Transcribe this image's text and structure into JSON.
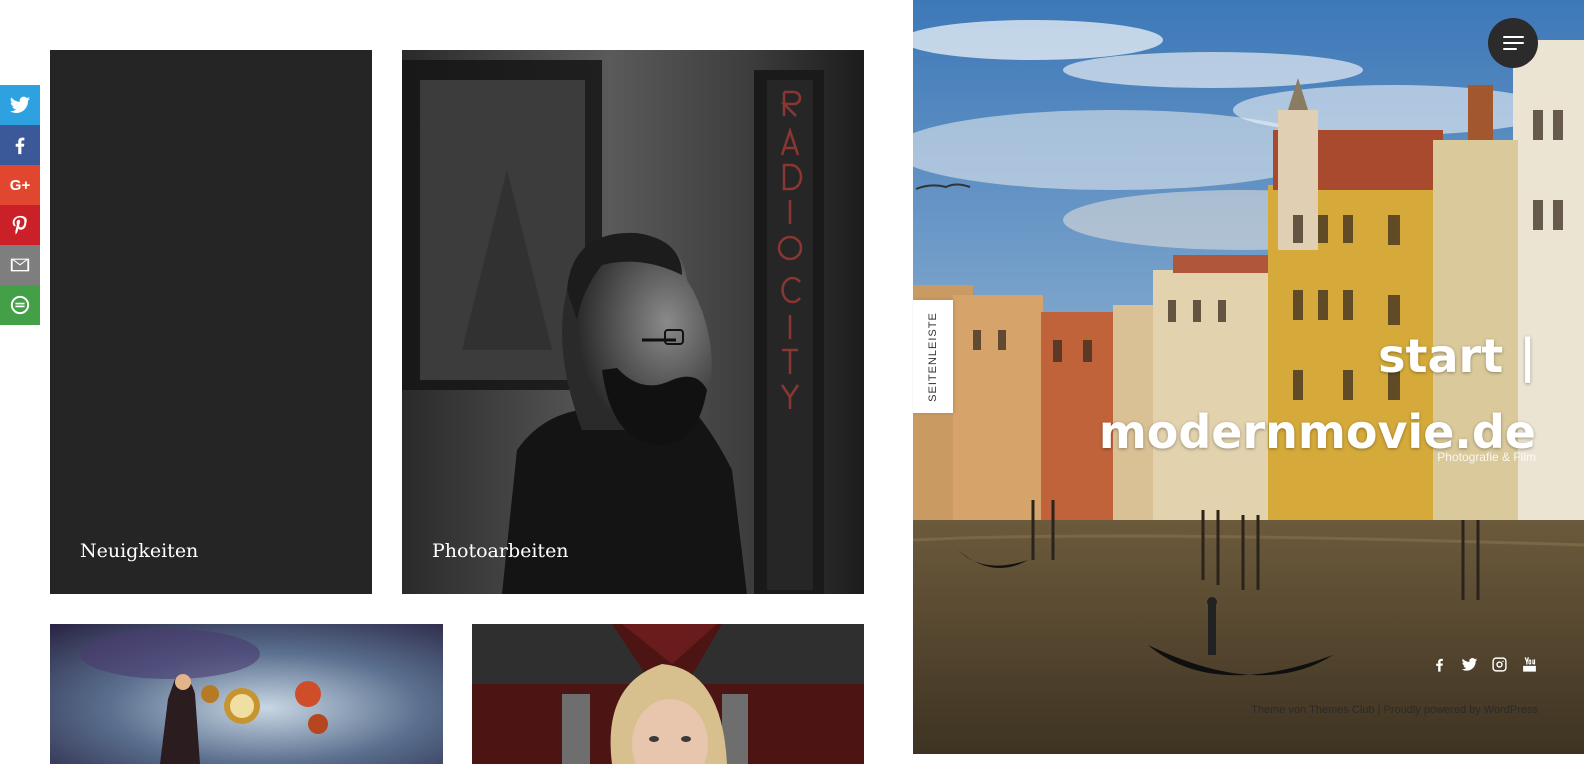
{
  "share": {
    "buttons": [
      {
        "name": "twitter",
        "icon": "twitter-icon",
        "color": "#2ea2e0"
      },
      {
        "name": "facebook",
        "icon": "facebook-icon",
        "color": "#3b5898"
      },
      {
        "name": "google-plus",
        "icon": "google-plus-icon",
        "color": "#e1462e",
        "glyph": "G+"
      },
      {
        "name": "pinterest",
        "icon": "pinterest-icon",
        "color": "#cb2027"
      },
      {
        "name": "email",
        "icon": "mail-icon",
        "color": "#7e7e7e"
      },
      {
        "name": "more",
        "icon": "share-more-icon",
        "color": "#43a047"
      }
    ]
  },
  "tiles": {
    "news": {
      "label": "Neuigkeiten"
    },
    "photo": {
      "label": "Photoarbeiten"
    }
  },
  "sidebar": {
    "tab_label": "SEITENLEISTE"
  },
  "hero": {
    "title": "start | modernmovie.de",
    "tagline": "Photografie & Film",
    "social": [
      "facebook-icon",
      "twitter-icon",
      "instagram-icon",
      "youtube-icon"
    ],
    "menu_icon": "hamburger-menu-icon"
  },
  "footer": {
    "prefix": "Theme von",
    "theme_link": "Themes Club",
    "middle": "| Proudly powered by",
    "wp_link": "WordPress"
  }
}
